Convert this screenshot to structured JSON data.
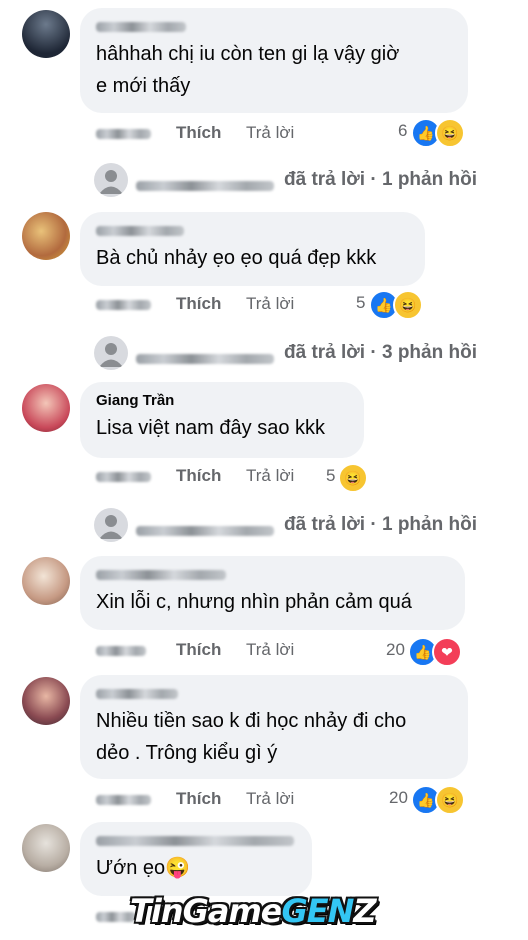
{
  "comments": [
    {
      "text": "hâhhah chị iu còn ten gi lạ vậy giờ\ne mới thấy",
      "like_label": "Thích",
      "reply_label": "Trả lời",
      "reaction_count": "6",
      "reactions": [
        "like",
        "haha"
      ],
      "replies_text": "đã trả lời · 1 phản hồi"
    },
    {
      "text": "Bà chủ nhảy ẹo ẹo quá đẹp kkk",
      "like_label": "Thích",
      "reply_label": "Trả lời",
      "reaction_count": "5",
      "reactions": [
        "like",
        "haha"
      ],
      "replies_text": "đã trả lời · 3 phản hồi"
    },
    {
      "name": "Giang Trần",
      "text": "Lisa việt nam đây sao kkk",
      "like_label": "Thích",
      "reply_label": "Trả lời",
      "reaction_count": "5",
      "reactions": [
        "haha"
      ],
      "replies_text": "đã trả lời · 1 phản hồi"
    },
    {
      "text": "Xin lỗi c, nhưng nhìn phản cảm quá",
      "like_label": "Thích",
      "reply_label": "Trả lời",
      "reaction_count": "20",
      "reactions": [
        "like",
        "love"
      ]
    },
    {
      "text": "Nhiều tiền sao k đi học nhảy đi cho\ndẻo . Trông kiểu gì ý",
      "like_label": "Thích",
      "reply_label": "Trả lời",
      "reaction_count": "20",
      "reactions": [
        "like",
        "haha"
      ]
    },
    {
      "text": "Ướn ẹo😜"
    }
  ],
  "watermark": {
    "part1": "TinGame",
    "part2": "GEN",
    "part3": "Z"
  },
  "icons": {
    "like": "thumbs-up-icon",
    "haha": "laughing-face-icon",
    "love": "heart-icon"
  },
  "colors": {
    "like_blue": "#1877f2",
    "haha_yellow": "#f7c531",
    "love_red": "#f33e58",
    "bubble": "#f0f2f5",
    "meta_gray": "#65676b"
  }
}
